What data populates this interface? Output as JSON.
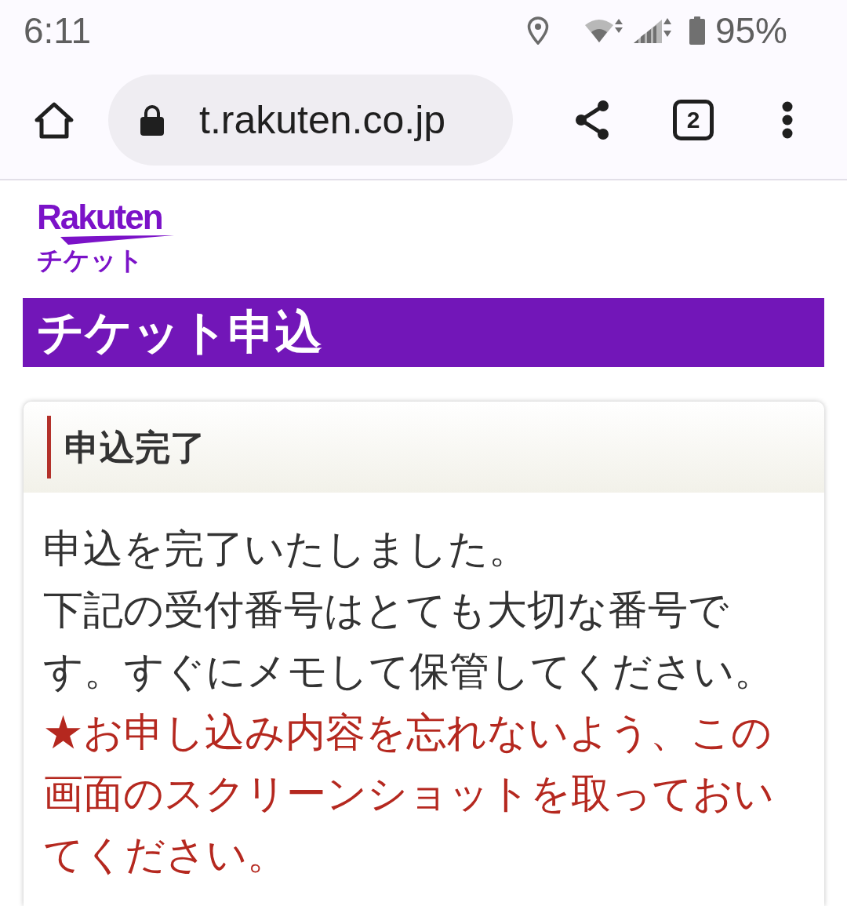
{
  "status_bar": {
    "time": "6:11",
    "battery": "95%"
  },
  "browser": {
    "url": "t.rakuten.co.jp",
    "tab_count": "2"
  },
  "logo": {
    "wordmark": "Rakuten",
    "subtitle": "チケット"
  },
  "page_title": "チケット申込",
  "card": {
    "heading": "申込完了",
    "paragraphs": [
      {
        "kind": "normal",
        "text": "申込を完了いたしました。"
      },
      {
        "kind": "normal",
        "text": "下記の受付番号はとても大切な番号です。すぐにメモして保管してください。"
      },
      {
        "kind": "warning",
        "text": "★お申し込み内容を忘れないよう、この画面のスクリーンショットを取っておいてください。"
      }
    ]
  }
}
